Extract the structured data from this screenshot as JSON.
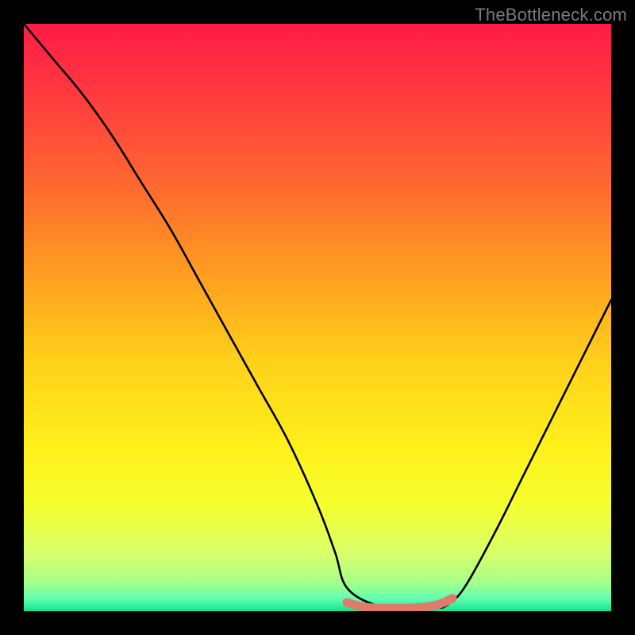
{
  "watermark": "TheBottleneck.com",
  "chart_data": {
    "type": "line",
    "title": "",
    "xlabel": "",
    "ylabel": "",
    "xlim": [
      0,
      100
    ],
    "ylim": [
      0,
      100
    ],
    "gradient_stops": [
      {
        "offset": 0.0,
        "color": "#ff1b46"
      },
      {
        "offset": 0.12,
        "color": "#ff3a3f"
      },
      {
        "offset": 0.28,
        "color": "#ff6a2f"
      },
      {
        "offset": 0.44,
        "color": "#ffa31f"
      },
      {
        "offset": 0.58,
        "color": "#ffd21a"
      },
      {
        "offset": 0.72,
        "color": "#fff01a"
      },
      {
        "offset": 0.82,
        "color": "#f4ff2f"
      },
      {
        "offset": 0.9,
        "color": "#d9ff6a"
      },
      {
        "offset": 0.95,
        "color": "#a8ff8a"
      },
      {
        "offset": 0.98,
        "color": "#5dffb2"
      },
      {
        "offset": 1.0,
        "color": "#11e28e"
      }
    ],
    "series": [
      {
        "name": "bottleneck-curve",
        "color": "#000000",
        "x": [
          0,
          5,
          10,
          15,
          20,
          25,
          30,
          35,
          40,
          45,
          50,
          53,
          55,
          60,
          65,
          70,
          72,
          75,
          80,
          85,
          90,
          95,
          100
        ],
        "values": [
          100,
          94,
          88,
          81,
          73,
          65,
          56,
          47,
          38,
          29,
          18,
          10,
          4,
          1,
          0.6,
          0.6,
          1,
          4,
          13,
          23,
          33,
          43,
          53
        ]
      },
      {
        "name": "optimal-band",
        "type": "marker",
        "color": "#e07a6a",
        "x": [
          55,
          57,
          59,
          61,
          63,
          65,
          67,
          69,
          71,
          73
        ],
        "values": [
          1.5,
          0.9,
          0.6,
          0.5,
          0.5,
          0.5,
          0.6,
          0.8,
          1.3,
          2.2
        ]
      }
    ]
  }
}
